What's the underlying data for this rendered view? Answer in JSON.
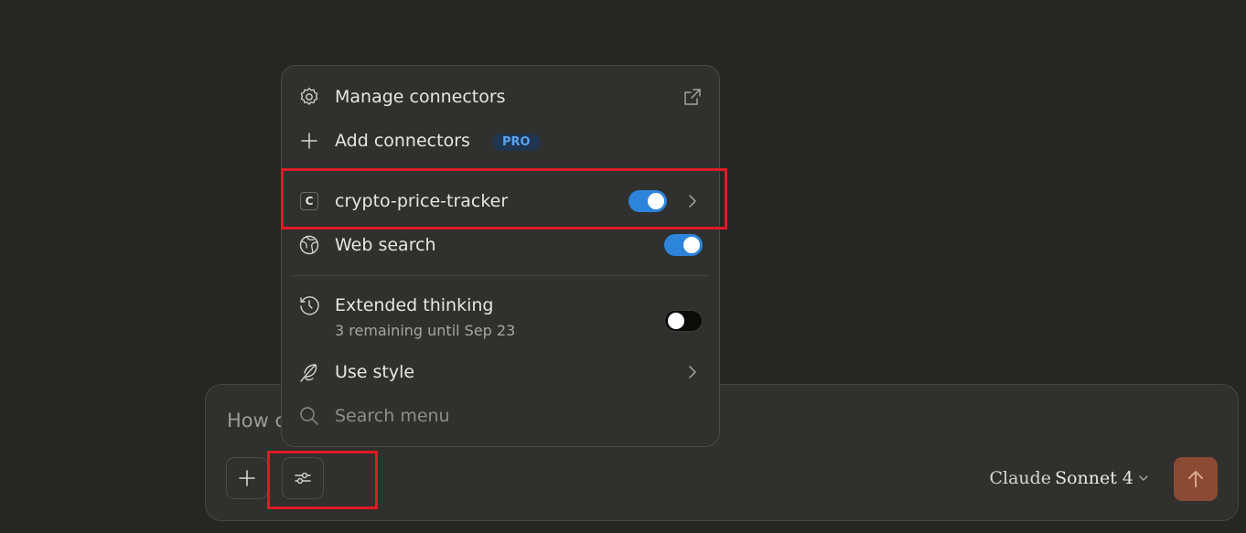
{
  "composer": {
    "placeholder": "How can I help you today?",
    "model_prefix": "Claude",
    "model_name": "Sonnet 4",
    "add_icon": "plus-icon",
    "tools_icon": "sliders-icon",
    "send_icon": "arrow-up-icon",
    "send_color": "#8a4a33"
  },
  "menu": {
    "manage_connectors": {
      "label": "Manage connectors",
      "icon": "gear-icon",
      "trailing_icon": "external-link-icon"
    },
    "add_connectors": {
      "label": "Add connectors",
      "icon": "plus-icon",
      "badge": "PRO"
    },
    "connector": {
      "label": "crypto-price-tracker",
      "icon_letter": "C",
      "enabled": true
    },
    "web_search": {
      "label": "Web search",
      "icon": "globe-icon",
      "enabled": true
    },
    "extended_thinking": {
      "label": "Extended thinking",
      "sublabel": "3 remaining until Sep 23",
      "icon": "clock-icon",
      "enabled": false
    },
    "use_style": {
      "label": "Use style",
      "icon": "feather-icon"
    },
    "search": {
      "placeholder": "Search menu",
      "icon": "search-icon"
    }
  },
  "colors": {
    "toggle_on": "#2c84db",
    "highlight": "#e01b24",
    "badge_text": "#5aa3ef"
  }
}
